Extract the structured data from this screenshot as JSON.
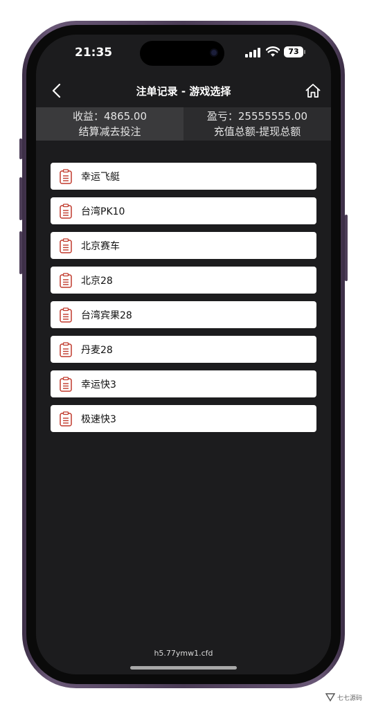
{
  "status": {
    "time": "21:35",
    "battery": "73",
    "signal_icon": "cellular-signal-icon",
    "wifi_icon": "wifi-icon"
  },
  "nav": {
    "title": "注单记录 - 游戏选择",
    "back_icon": "chevron-left-icon",
    "home_icon": "home-icon"
  },
  "summary": {
    "income_label": "收益：4865.00",
    "income_desc": "结算减去投注",
    "profit_label": "盈亏：25555555.00",
    "profit_desc": "充值总额-提现总额"
  },
  "games": [
    {
      "name": "幸运飞艇"
    },
    {
      "name": "台湾PK10"
    },
    {
      "name": "北京赛车"
    },
    {
      "name": "北京28"
    },
    {
      "name": "台湾宾果28"
    },
    {
      "name": "丹麦28"
    },
    {
      "name": "幸运快3"
    },
    {
      "name": "极速快3"
    }
  ],
  "footer": {
    "url": "h5.77ymw1.cfd"
  },
  "watermark": {
    "text": "七七源码"
  },
  "colors": {
    "icon_accent": "#c0392b",
    "background": "#1c1c1e"
  }
}
